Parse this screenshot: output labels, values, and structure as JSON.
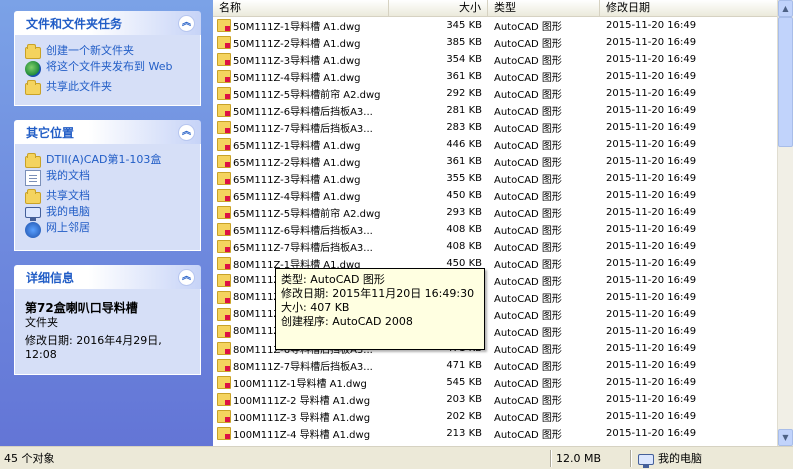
{
  "taskpane": {
    "file_tasks": {
      "title": "文件和文件夹任务",
      "items": [
        {
          "label": "创建一个新文件夹",
          "icon": "new-folder-icon"
        },
        {
          "label": "将这个文件夹发布到 Web",
          "icon": "publish-web-icon"
        },
        {
          "label": "共享此文件夹",
          "icon": "share-folder-icon"
        }
      ]
    },
    "other_places": {
      "title": "其它位置",
      "items": [
        {
          "label": "DTII(A)CAD第1-103盒",
          "icon": "folder-icon"
        },
        {
          "label": "我的文档",
          "icon": "my-documents-icon"
        },
        {
          "label": "共享文档",
          "icon": "shared-documents-icon"
        },
        {
          "label": "我的电脑",
          "icon": "my-computer-icon"
        },
        {
          "label": "网上邻居",
          "icon": "network-icon"
        }
      ]
    },
    "details": {
      "title": "详细信息",
      "name": "第72盒喇叭口导料槽",
      "kind": "文件夹",
      "modified_label": "修改日期: 2016年4月29日, 12:08"
    }
  },
  "columns": {
    "name": "名称",
    "size": "大小",
    "type": "类型",
    "date": "修改日期"
  },
  "files": [
    {
      "name": "50M111Z-1导料槽 A1.dwg",
      "size": "345 KB",
      "type": "AutoCAD 图形",
      "date": "2015-11-20 16:49"
    },
    {
      "name": "50M111Z-2导料槽 A1.dwg",
      "size": "385 KB",
      "type": "AutoCAD 图形",
      "date": "2015-11-20 16:49"
    },
    {
      "name": "50M111Z-3导料槽 A1.dwg",
      "size": "354 KB",
      "type": "AutoCAD 图形",
      "date": "2015-11-20 16:49"
    },
    {
      "name": "50M111Z-4导料槽 A1.dwg",
      "size": "361 KB",
      "type": "AutoCAD 图形",
      "date": "2015-11-20 16:49"
    },
    {
      "name": "50M111Z-5导料槽前帘 A2.dwg",
      "size": "292 KB",
      "type": "AutoCAD 图形",
      "date": "2015-11-20 16:49"
    },
    {
      "name": "50M111Z-6导料槽后挡板A3...",
      "size": "281 KB",
      "type": "AutoCAD 图形",
      "date": "2015-11-20 16:49"
    },
    {
      "name": "50M111Z-7导料槽后挡板A3...",
      "size": "283 KB",
      "type": "AutoCAD 图形",
      "date": "2015-11-20 16:49"
    },
    {
      "name": "65M111Z-1导料槽 A1.dwg",
      "size": "446 KB",
      "type": "AutoCAD 图形",
      "date": "2015-11-20 16:49"
    },
    {
      "name": "65M111Z-2导料槽 A1.dwg",
      "size": "361 KB",
      "type": "AutoCAD 图形",
      "date": "2015-11-20 16:49"
    },
    {
      "name": "65M111Z-3导料槽 A1.dwg",
      "size": "355 KB",
      "type": "AutoCAD 图形",
      "date": "2015-11-20 16:49"
    },
    {
      "name": "65M111Z-4导料槽 A1.dwg",
      "size": "450 KB",
      "type": "AutoCAD 图形",
      "date": "2015-11-20 16:49"
    },
    {
      "name": "65M111Z-5导料槽前帘 A2.dwg",
      "size": "293 KB",
      "type": "AutoCAD 图形",
      "date": "2015-11-20 16:49"
    },
    {
      "name": "65M111Z-6导料槽后挡板A3...",
      "size": "408 KB",
      "type": "AutoCAD 图形",
      "date": "2015-11-20 16:49"
    },
    {
      "name": "65M111Z-7导料槽后挡板A3...",
      "size": "408 KB",
      "type": "AutoCAD 图形",
      "date": "2015-11-20 16:49"
    },
    {
      "name": "80M111Z-1导料槽 A1.dwg",
      "size": "450 KB",
      "type": "AutoCAD 图形",
      "date": "2015-11-20 16:49"
    },
    {
      "name": "80M111Z",
      "size": "",
      "type": "AutoCAD 图形",
      "date": "2015-11-20 16:49"
    },
    {
      "name": "80M111Z",
      "size": "",
      "type": "AutoCAD 图形",
      "date": "2015-11-20 16:49"
    },
    {
      "name": "80M111Z",
      "size": "",
      "type": "AutoCAD 图形",
      "date": "2015-11-20 16:49"
    },
    {
      "name": "80M111Z",
      "size": "",
      "type": "AutoCAD 图形",
      "date": "2015-11-20 16:49"
    },
    {
      "name": "80M111Z-6导料槽后挡板A3...",
      "size": "471 KB",
      "type": "AutoCAD 图形",
      "date": "2015-11-20 16:49"
    },
    {
      "name": "80M111Z-7导料槽后挡板A3...",
      "size": "471 KB",
      "type": "AutoCAD 图形",
      "date": "2015-11-20 16:49"
    },
    {
      "name": "100M111Z-1导料槽 A1.dwg",
      "size": "545 KB",
      "type": "AutoCAD 图形",
      "date": "2015-11-20 16:49"
    },
    {
      "name": "100M111Z-2 导料槽 A1.dwg",
      "size": "203 KB",
      "type": "AutoCAD 图形",
      "date": "2015-11-20 16:49"
    },
    {
      "name": "100M111Z-3 导料槽 A1.dwg",
      "size": "202 KB",
      "type": "AutoCAD 图形",
      "date": "2015-11-20 16:49"
    },
    {
      "name": "100M111Z-4 导料槽 A1.dwg",
      "size": "213 KB",
      "type": "AutoCAD 图形",
      "date": "2015-11-20 16:49"
    }
  ],
  "tooltip": {
    "type": "类型: AutoCAD 图形",
    "modified": "修改日期: 2015年11月20日 16:49:30",
    "size": "大小: 407 KB",
    "creator": "创建程序: AutoCAD 2008"
  },
  "statusbar": {
    "count": "45 个对象",
    "size": "12.0 MB",
    "location": "我的电脑"
  }
}
